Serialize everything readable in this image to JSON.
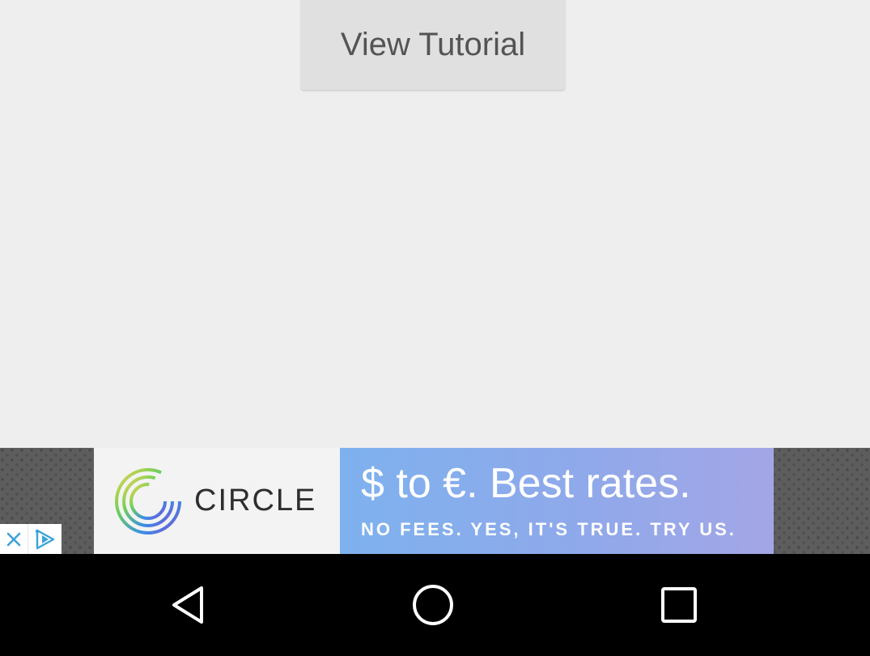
{
  "main": {
    "tutorial_button_label": "View Tutorial"
  },
  "ad": {
    "brand": "CIRCLE",
    "headline": "$ to €. Best rates.",
    "subline": "NO FEES. YES, IT'S TRUE. TRY US.",
    "close_icon": "close-icon",
    "adchoices_icon": "adchoices-icon",
    "colors": {
      "banner_blue": "#8fa9ea",
      "logo_green": "#6ccf5b",
      "logo_blue": "#3a8ee6",
      "logo_purple": "#7a4fd6"
    }
  },
  "navbar": {
    "back_icon": "back-triangle-icon",
    "home_icon": "home-circle-icon",
    "recents_icon": "recents-square-icon"
  }
}
